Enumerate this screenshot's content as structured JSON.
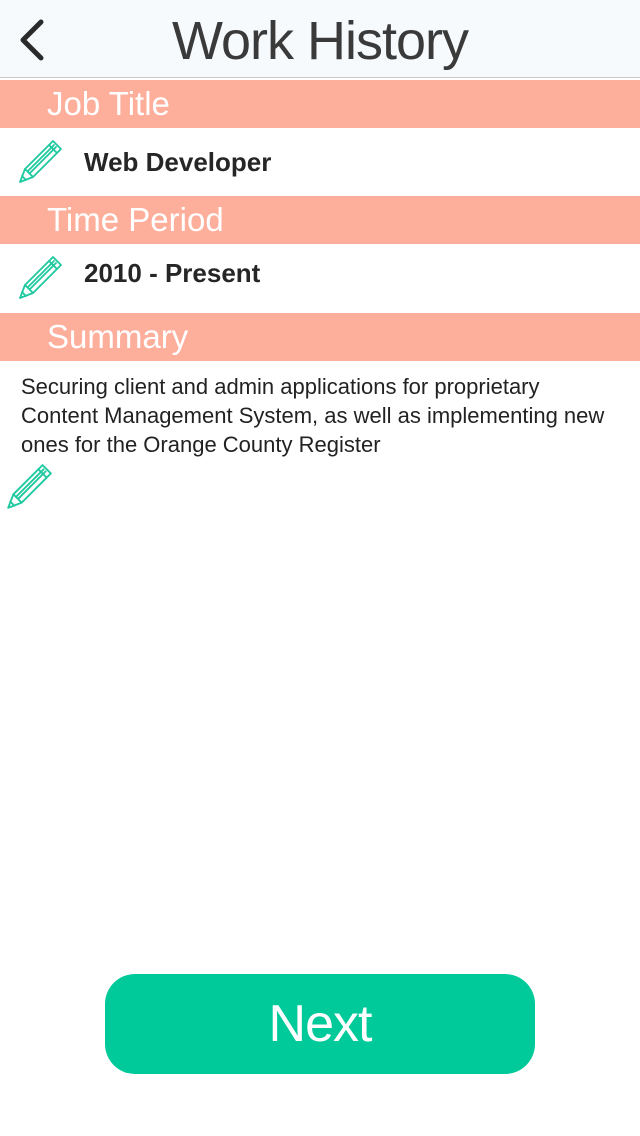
{
  "nav": {
    "title": "Work History",
    "back_icon": "chevron-left-icon"
  },
  "sections": {
    "job_title": {
      "header": "Job Title",
      "value": "Web Developer",
      "edit_icon": "pencil-icon"
    },
    "time_period": {
      "header": "Time Period",
      "value": "2010 - Present",
      "edit_icon": "pencil-icon"
    },
    "summary": {
      "header": "Summary",
      "text": "Securing client and admin applications for proprietary Content Management System, as well as implementing new ones for the Orange County Register",
      "edit_icon": "pencil-icon"
    }
  },
  "footer": {
    "next_label": "Next"
  },
  "colors": {
    "header_bg": "#feaf9c",
    "accent": "#00c99a",
    "pencil": "#1ec9a0",
    "navbar_bg": "#f6fafd"
  }
}
